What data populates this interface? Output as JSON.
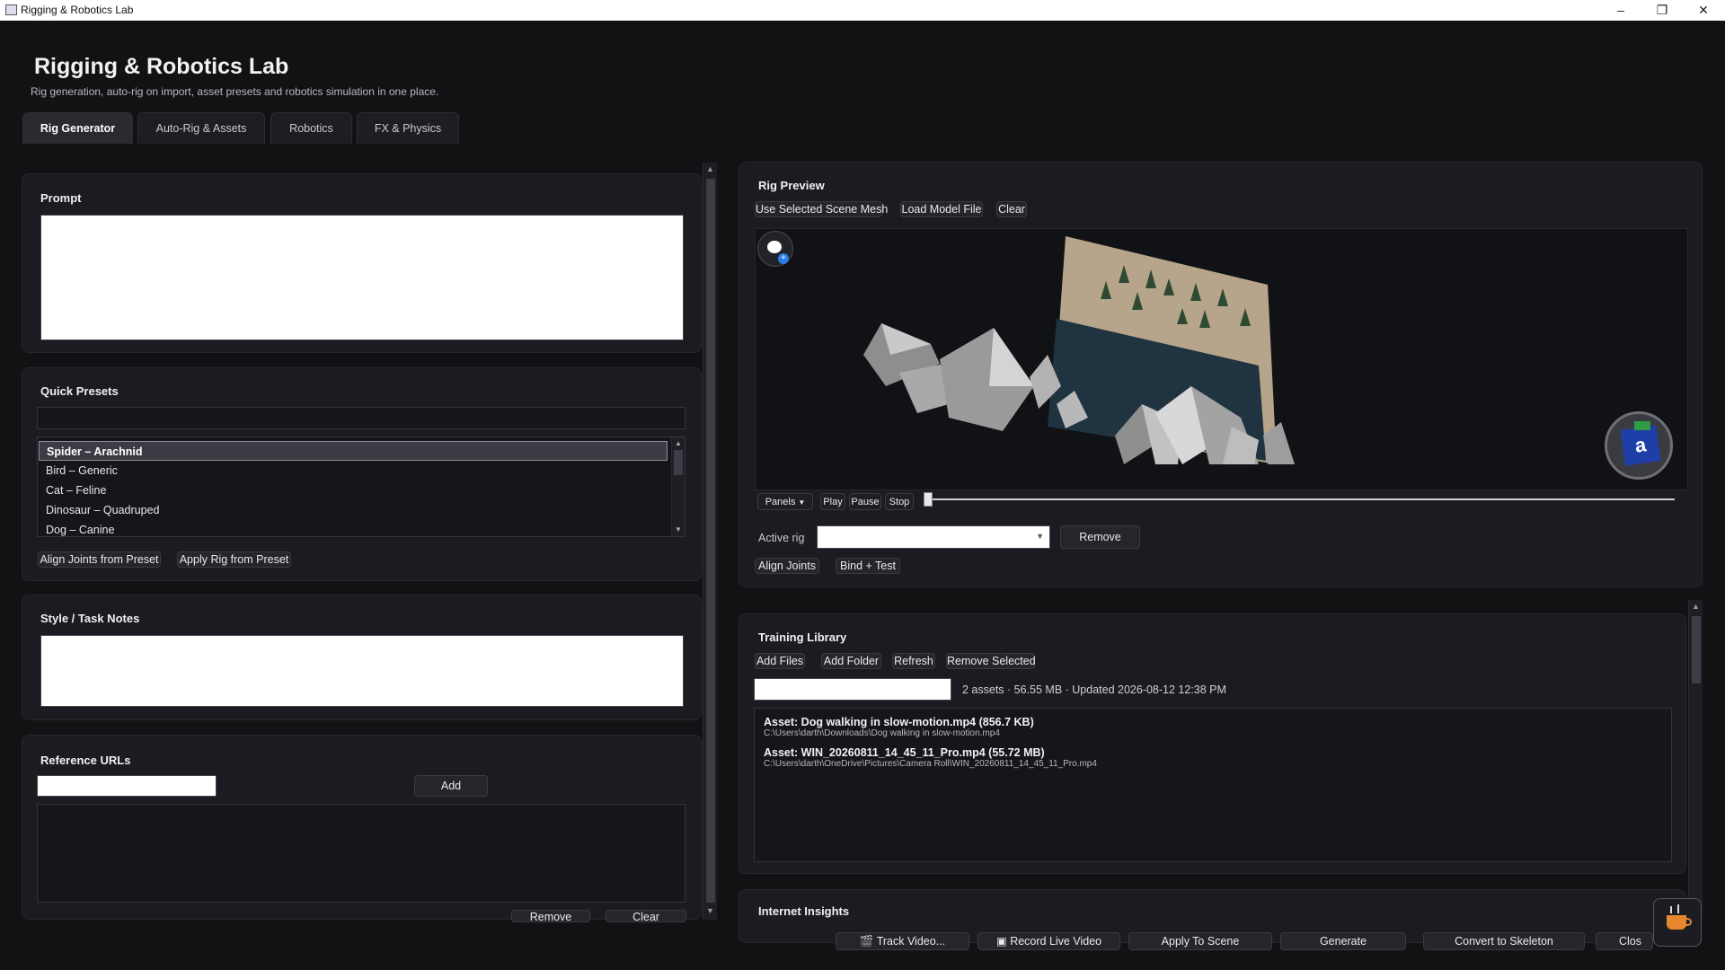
{
  "window": {
    "title": "Rigging & Robotics Lab"
  },
  "header": {
    "title": "Rigging & Robotics Lab",
    "subtitle": "Rig generation, auto-rig on import, asset presets and robotics simulation in one place."
  },
  "tabs": [
    {
      "label": "Rig Generator",
      "active": true
    },
    {
      "label": "Auto-Rig & Assets",
      "active": false
    },
    {
      "label": "Robotics",
      "active": false
    },
    {
      "label": "FX & Physics",
      "active": false
    }
  ],
  "left": {
    "prompt": {
      "title": "Prompt",
      "value": ""
    },
    "quick_presets": {
      "title": "Quick Presets",
      "filter_value": "",
      "items": [
        {
          "label": "Spider – Arachnid",
          "selected": true
        },
        {
          "label": "Bird – Generic",
          "selected": false
        },
        {
          "label": "Cat – Feline",
          "selected": false
        },
        {
          "label": "Dinosaur – Quadruped",
          "selected": false
        },
        {
          "label": "Dog – Canine",
          "selected": false
        }
      ],
      "align_button": "Align Joints from Preset",
      "apply_button": "Apply Rig from Preset"
    },
    "style_notes": {
      "title": "Style / Task Notes",
      "value": ""
    },
    "reference_urls": {
      "title": "Reference URLs",
      "input_value": "",
      "add_button": "Add",
      "remove_button": "Remove",
      "clear_button": "Clear"
    }
  },
  "rig_preview": {
    "title": "Rig Preview",
    "buttons": {
      "use_mesh": "Use Selected Scene Mesh",
      "load_model": "Load Model File",
      "clear": "Clear"
    },
    "playback": {
      "panels": "Panels",
      "play": "Play",
      "pause": "Pause",
      "stop": "Stop",
      "timeline_position": 0
    },
    "active_rig_label": "Active rig",
    "active_rig_value": "",
    "remove_button": "Remove",
    "align_joints": "Align Joints",
    "bind_test": "Bind + Test"
  },
  "training_library": {
    "title": "Training Library",
    "buttons": {
      "add_files": "Add Files",
      "add_folder": "Add Folder",
      "refresh": "Refresh",
      "remove_selected": "Remove Selected"
    },
    "search_value": "",
    "summary": "2 assets · 56.55 MB · Updated 2026-08-12 12:38 PM",
    "assets": [
      {
        "title": "Asset: Dog walking in slow-motion.mp4 (856.7 KB)",
        "path": "C:\\Users\\darth\\Downloads\\Dog walking in slow-motion.mp4"
      },
      {
        "title": "Asset: WIN_20260811_14_45_11_Pro.mp4 (55.72 MB)",
        "path": "C:\\Users\\darth\\OneDrive\\Pictures\\Camera Roll\\WIN_20260811_14_45_11_Pro.mp4"
      }
    ]
  },
  "internet_insights": {
    "title": "Internet Insights"
  },
  "bottom_bar": {
    "track_video": "Track Video...",
    "record_live": "Record Live Video",
    "apply_scene": "Apply To Scene",
    "generate": "Generate",
    "convert_skeleton": "Convert to Skeleton",
    "close": "Clos"
  },
  "colors": {
    "background": "#121214",
    "panel": "#1b1c21",
    "accent_blue": "#2d7be5"
  }
}
